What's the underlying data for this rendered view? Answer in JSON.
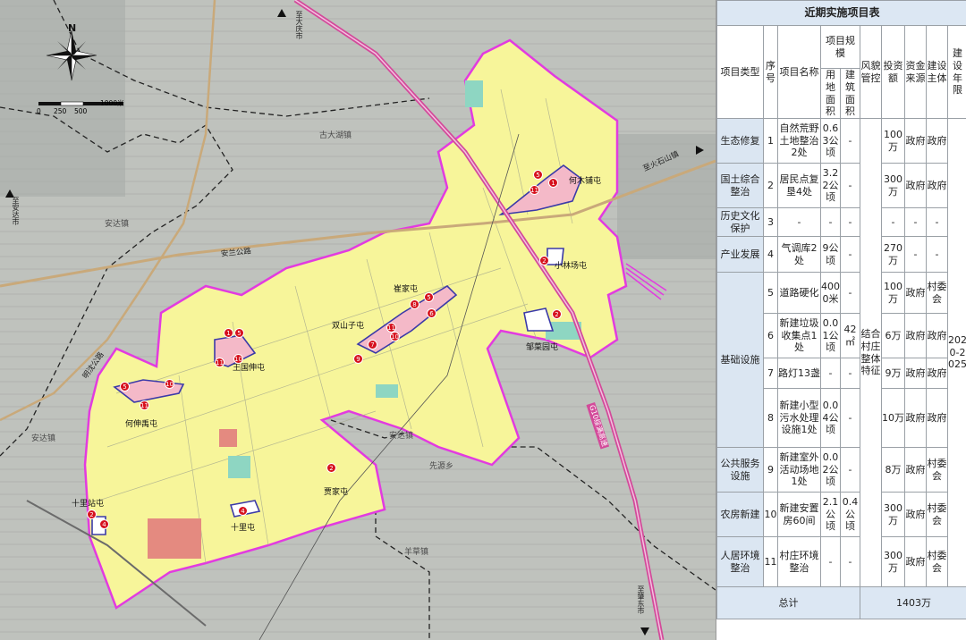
{
  "map": {
    "north_label": "N",
    "scale_labels": [
      "0",
      "250",
      "500",
      "1000米"
    ],
    "directions": {
      "daqing": "至大庆市",
      "anda": "至安达市",
      "huoshishan": "至火石山镇",
      "zhaodong": "至肇东市"
    },
    "towns": {
      "gudahu": "古大湖镇",
      "anda_town_nw": "安达镇",
      "anda_town_w": "安达镇",
      "anda_town_c": "安达镇",
      "xianyuan": "先源乡",
      "yangcao": "羊草镇"
    },
    "roads": {
      "anlan": "安兰公路",
      "mingshen": "明沈公路",
      "g10": "G10绥满高速"
    },
    "villages": {
      "hemupu": "何木铺屯",
      "xiaolinchang": "小林场屯",
      "cuijia": "崔家屯",
      "shuangshanzi": "双山子屯",
      "zoucaiyuan": "邹菜园屯",
      "wangguoshen": "王国伸屯",
      "heshenyu": "何伸禹屯",
      "jia": "贾家屯",
      "shilizhan": "十里站屯",
      "shili": "十里屯"
    },
    "markers": [
      {
        "id": "m1",
        "n": "5"
      },
      {
        "id": "m2",
        "n": "11"
      },
      {
        "id": "m3",
        "n": "1"
      },
      {
        "id": "m4",
        "n": "2"
      },
      {
        "id": "m5",
        "n": "5"
      },
      {
        "id": "m6",
        "n": "8"
      },
      {
        "id": "m7",
        "n": "6"
      },
      {
        "id": "m8",
        "n": "11"
      },
      {
        "id": "m9",
        "n": "10"
      },
      {
        "id": "m10",
        "n": "7"
      },
      {
        "id": "m11",
        "n": "9"
      },
      {
        "id": "m12",
        "n": "2"
      },
      {
        "id": "m13",
        "n": "1"
      },
      {
        "id": "m14",
        "n": "5"
      },
      {
        "id": "m15",
        "n": "11"
      },
      {
        "id": "m16",
        "n": "10"
      },
      {
        "id": "m17",
        "n": "5"
      },
      {
        "id": "m18",
        "n": "10"
      },
      {
        "id": "m19",
        "n": "11"
      },
      {
        "id": "m20",
        "n": "2"
      },
      {
        "id": "m21",
        "n": "2"
      },
      {
        "id": "m22",
        "n": "4"
      },
      {
        "id": "m23",
        "n": "4"
      }
    ]
  },
  "table": {
    "title": "近期实施项目表",
    "headers": {
      "type": "项目类型",
      "seq": "序号",
      "name": "项目名称",
      "scale": "项目规模",
      "land": "用地面积",
      "build": "建筑面积",
      "style": "风貌管控",
      "invest": "投资额",
      "fund": "资金来源",
      "subject": "建设主体",
      "years": "建设年限"
    },
    "style_merged": "结合村庄整体特征",
    "years_merged": "2020-2025",
    "rows": [
      {
        "type": "生态修复",
        "seq": "1",
        "name": "自然荒野土地整治2处",
        "land": "0.6 3公顷",
        "build": "-",
        "invest": "100万",
        "fund": "政府",
        "subject": "政府"
      },
      {
        "type": "国土综合整治",
        "seq": "2",
        "name": "居民点复垦4处",
        "land": "3.2 2公顷",
        "build": "-",
        "invest": "300万",
        "fund": "政府",
        "subject": "政府"
      },
      {
        "type": "历史文化保护",
        "seq": "3",
        "name": "-",
        "land": "-",
        "build": "-",
        "invest": "-",
        "fund": "-",
        "subject": "-"
      },
      {
        "type": "产业发展",
        "seq": "4",
        "name": "气调库2处",
        "land": "9公顷",
        "build": "-",
        "invest": "270万",
        "fund": "-",
        "subject": "-"
      },
      {
        "seq": "5",
        "name": "道路硬化",
        "land": "400 0米",
        "build": "-",
        "invest": "100万",
        "fund": "政府",
        "subject": "村委会"
      },
      {
        "seq": "6",
        "name": "新建垃圾收集点1处",
        "land": "0.0 1公顷",
        "build": "42 ㎡",
        "invest": "6万",
        "fund": "政府",
        "subject": "政府"
      },
      {
        "seq": "7",
        "name": "路灯13盏",
        "land": "-",
        "build": "-",
        "invest": "9万",
        "fund": "政府",
        "subject": "政府"
      },
      {
        "seq": "8",
        "name": "新建小型污水处理设施1处",
        "land": "0.0 4公顷",
        "build": "-",
        "invest": "10万",
        "fund": "政府",
        "subject": "政府"
      },
      {
        "type": "公共服务设施",
        "seq": "9",
        "name": "新建室外活动场地1处",
        "land": "0.0 2公顷",
        "build": "-",
        "invest": "8万",
        "fund": "政府",
        "subject": "村委会"
      },
      {
        "type": "农房新建",
        "seq": "10",
        "name": "新建安置房60间",
        "land": "2.1 公顷",
        "build": "0.4 公顷",
        "invest": "300万",
        "fund": "政府",
        "subject": "村委会"
      },
      {
        "type": "人居环境整治",
        "seq": "11",
        "name": "村庄环境整治",
        "land": "-",
        "build": "-",
        "invest": "300万",
        "fund": "政府",
        "subject": "村委会"
      }
    ],
    "infra_type": "基础设施",
    "total_label": "总计",
    "total_value": "1403万"
  },
  "colors": {
    "boundary": "#e23be0",
    "planning_area": "#f7f59a",
    "highway": "#d34a9a",
    "marker": "#d6111d",
    "header_bg": "#dce7f3"
  }
}
